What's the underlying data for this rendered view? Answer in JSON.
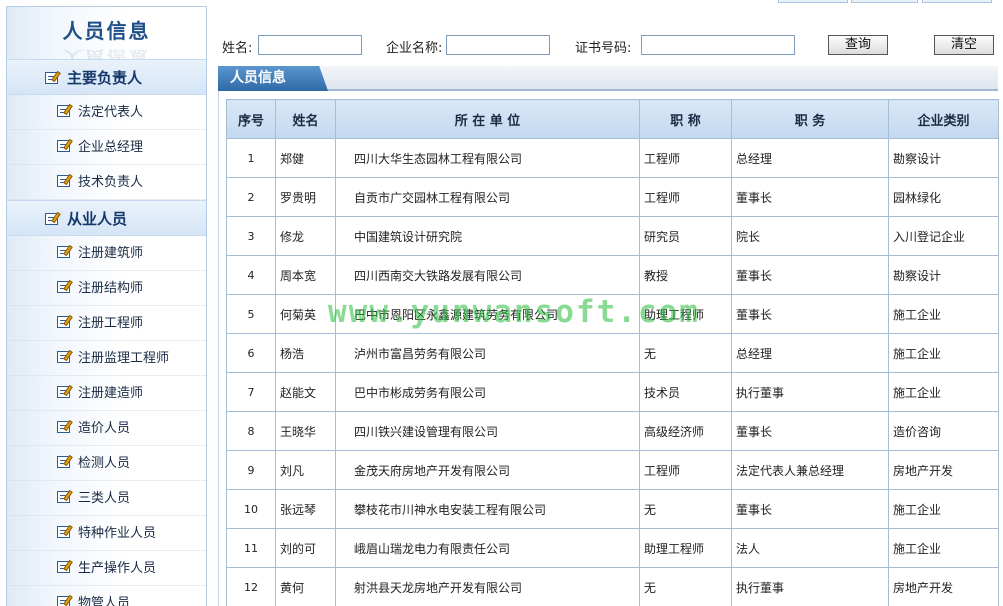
{
  "sidebar": {
    "title": "人员信息",
    "sections": [
      {
        "label": "主要负责人",
        "items": [
          "法定代表人",
          "企业总经理",
          "技术负责人"
        ]
      },
      {
        "label": "从业人员",
        "items": [
          "注册建筑师",
          "注册结构师",
          "注册工程师",
          "注册监理工程师",
          "注册建造师",
          "造价人员",
          "检测人员",
          "三类人员",
          "特种作业人员",
          "生产操作人员",
          "物管人员"
        ]
      }
    ]
  },
  "search": {
    "name_label": "姓名:",
    "name_value": "",
    "company_label": "企业名称:",
    "company_value": "",
    "cert_label": "证书号码:",
    "cert_value": "",
    "query_button": "查询",
    "clear_button": "清空"
  },
  "panel": {
    "title": "人员信息"
  },
  "table": {
    "headers": [
      "序号",
      "姓名",
      "所 在 单 位",
      "职 称",
      "职 务",
      "企业类别"
    ],
    "rows": [
      [
        "1",
        "郑健",
        "四川大华生态园林工程有限公司",
        "工程师",
        "总经理",
        "勘察设计"
      ],
      [
        "2",
        "罗贵明",
        "自贡市广交园林工程有限公司",
        "工程师",
        "董事长",
        "园林绿化"
      ],
      [
        "3",
        "修龙",
        "中国建筑设计研究院",
        "研究员",
        "院长",
        "入川登记企业"
      ],
      [
        "4",
        "周本宽",
        "四川西南交大铁路发展有限公司",
        "教授",
        "董事长",
        "勘察设计"
      ],
      [
        "5",
        "何菊英",
        "巴中市恩阳区永鑫源建筑劳务有限公司",
        "助理工程师",
        "董事长",
        "施工企业"
      ],
      [
        "6",
        "杨浩",
        "泸州市富昌劳务有限公司",
        "无",
        "总经理",
        "施工企业"
      ],
      [
        "7",
        "赵能文",
        "巴中市彬成劳务有限公司",
        "技术员",
        "执行董事",
        "施工企业"
      ],
      [
        "8",
        "王晓华",
        "四川铁兴建设管理有限公司",
        "高级经济师",
        "董事长",
        "造价咨询"
      ],
      [
        "9",
        "刘凡",
        "金茂天府房地产开发有限公司",
        "工程师",
        "法定代表人兼总经理",
        "房地产开发"
      ],
      [
        "10",
        "张远琴",
        "攀枝花市川神水电安装工程有限公司",
        "无",
        "董事长",
        "施工企业"
      ],
      [
        "11",
        "刘的可",
        "峨眉山瑞龙电力有限责任公司",
        "助理工程师",
        "法人",
        "施工企业"
      ],
      [
        "12",
        "黄何",
        "射洪县天龙房地产开发有限公司",
        "无",
        "执行董事",
        "房地产开发"
      ]
    ]
  },
  "watermark": "www.yunwansoft.com"
}
